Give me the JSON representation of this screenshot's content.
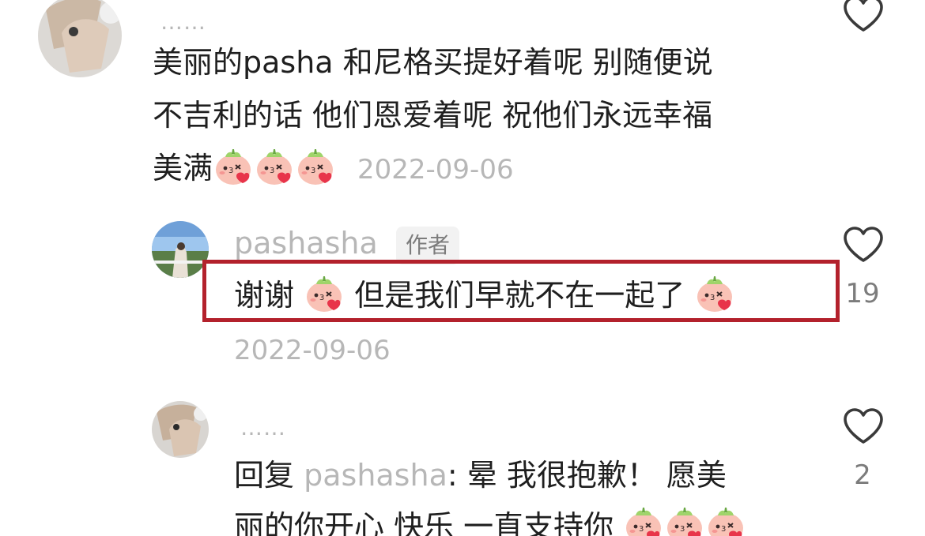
{
  "comments": [
    {
      "username": "……",
      "lines": [
        "美丽的pasha 和尼格买提好着呢 别随便说",
        "不吉利的话 他们恩爱着呢  祝他们永远幸福",
        "美满"
      ],
      "emoji_count": 3,
      "timestamp": "2022-09-06",
      "emoji_icon": "peach-blush-emoji-icon"
    },
    {
      "username": "pashasha",
      "badge": "作者",
      "line_part1": "谢谢",
      "line_part2": "但是我们早就不在一起了",
      "timestamp": "2022-09-06",
      "likes": "19",
      "emoji_icon": "peach-blush-emoji-icon"
    },
    {
      "username": "……",
      "reply_prefix": "回复",
      "reply_to": "pashasha",
      "reply_colon": ":",
      "line1_rest": " 晕  我很抱歉！ 愿美",
      "line2": "丽的你开心 快乐 一直支持你",
      "emoji_count": 3,
      "likes": "2",
      "emoji_icon": "peach-blush-emoji-icon"
    }
  ],
  "colors": {
    "text": "#1f1f1f",
    "muted": "#b7b7b7",
    "like_count": "#7c7c7c",
    "highlight": "#b3212c",
    "badge_bg": "#f2f2f2"
  }
}
